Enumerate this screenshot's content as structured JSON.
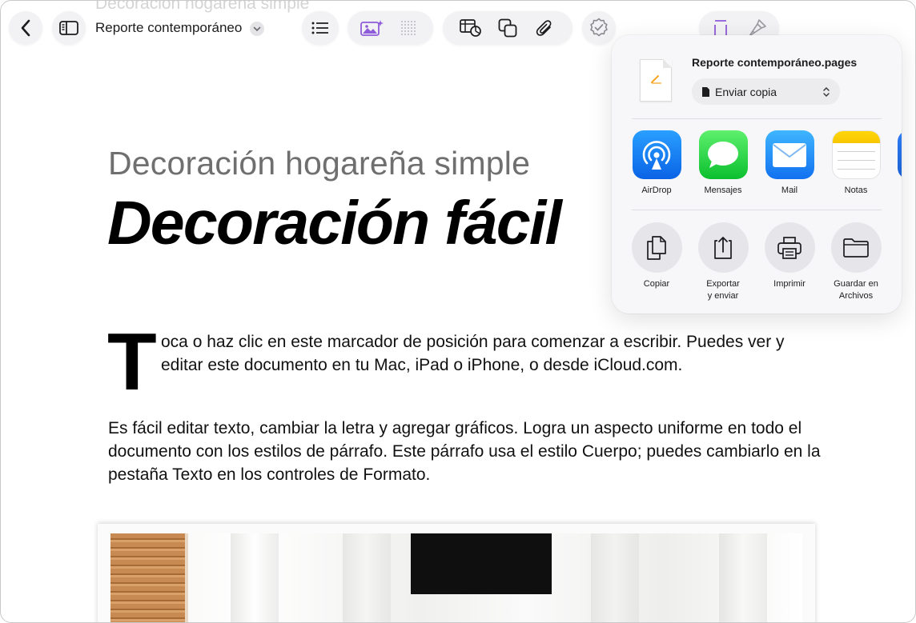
{
  "ghost_header": "Decoración hogareña simple",
  "toolbar": {
    "document_title": "Reporte contemporáneo"
  },
  "document": {
    "subtitle": "Decoración hogareña simple",
    "title": "Decoración fácil",
    "dropcap": "T",
    "para1": "oca o haz clic en este marcador de posición para comenzar a escribir. Puedes ver y editar este documento en tu Mac, iPad o iPhone, o desde iCloud.com.",
    "para2": "Es fácil editar texto, cambiar la letra y agregar gráficos. Logra un aspecto uniforme en todo el documento con los estilos de párrafo. Este párrafo usa el estilo Cuerpo; puedes cambiarlo en la pestaña Texto en los controles de Formato."
  },
  "share": {
    "file_name": "Reporte contemporáneo.pages",
    "send_option": "Enviar copia",
    "apps": [
      {
        "label": "AirDrop",
        "icon": "airdrop-icon"
      },
      {
        "label": "Mensajes",
        "icon": "messages-icon"
      },
      {
        "label": "Mail",
        "icon": "mail-icon"
      },
      {
        "label": "Notas",
        "icon": "notes-icon"
      }
    ],
    "actions": [
      {
        "label": "Copiar",
        "icon": "copy-icon"
      },
      {
        "label": "Exportar\ny enviar",
        "icon": "export-share-icon"
      },
      {
        "label": "Imprimir",
        "icon": "print-icon"
      },
      {
        "label": "Guardar en\nArchivos",
        "icon": "folder-icon"
      }
    ]
  },
  "colors": {
    "accent_purple": "#8e5bd9",
    "toolbar_bg": "#f2f2f4",
    "popover_bg": "#f7f7f9"
  }
}
